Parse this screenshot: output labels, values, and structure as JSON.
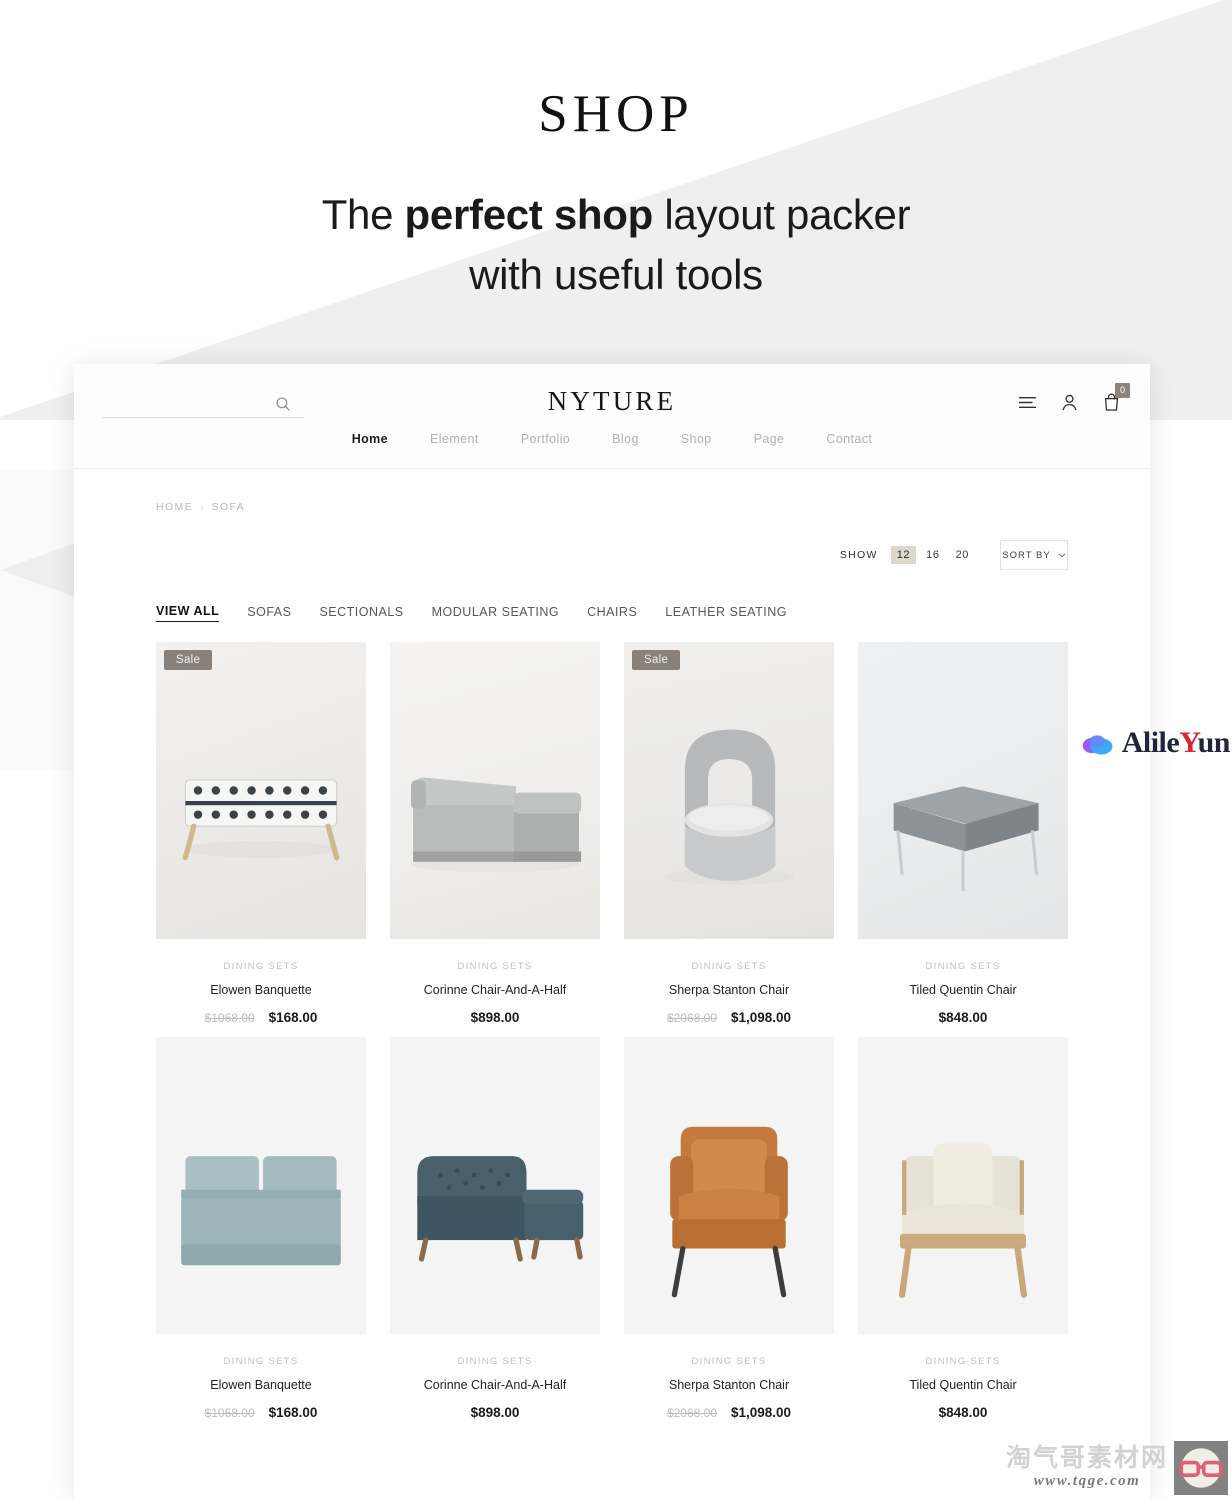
{
  "hero": {
    "title": "SHOP",
    "subtitle_line1_pre": "The ",
    "subtitle_line1_bold": "perfect shop",
    "subtitle_line1_post": " layout packer",
    "subtitle_line2": "with useful tools"
  },
  "header": {
    "brand": "NYTURE",
    "search_placeholder": "",
    "search_value": "",
    "icons": {
      "search": "search-icon",
      "menu": "hamburger-menu-icon",
      "account": "user-account-icon",
      "cart": "shopping-bag-icon"
    },
    "cart_count": "0",
    "nav": [
      {
        "label": "Home",
        "active": true
      },
      {
        "label": "Element",
        "active": false
      },
      {
        "label": "Portfolio",
        "active": false
      },
      {
        "label": "Blog",
        "active": false
      },
      {
        "label": "Shop",
        "active": false
      },
      {
        "label": "Page",
        "active": false
      },
      {
        "label": "Contact",
        "active": false
      }
    ]
  },
  "breadcrumb": {
    "home": "HOME",
    "separator": "›",
    "current": "SOFA"
  },
  "toolbar": {
    "show_label": "SHOW",
    "show_options": [
      {
        "label": "12",
        "active": true
      },
      {
        "label": "16",
        "active": false
      },
      {
        "label": "20",
        "active": false
      }
    ],
    "sort_label": "SORT BY",
    "sort_caret": "chevron-down-icon"
  },
  "category_tabs": [
    {
      "label": "VIEW ALL",
      "active": true
    },
    {
      "label": "SOFAS",
      "active": false
    },
    {
      "label": "SECTIONALS",
      "active": false
    },
    {
      "label": "MODULAR SEATING",
      "active": false
    },
    {
      "label": "CHAIRS",
      "active": false
    },
    {
      "label": "LEATHER SEATING",
      "active": false
    }
  ],
  "sale_badge_label": "Sale",
  "products_row1": [
    {
      "category": "DINING SETS",
      "name": "Elowen Banquette",
      "price_old": "$1068.00",
      "price_now": "$168.00",
      "on_sale": true,
      "image": "patterned-bench-gold-legs"
    },
    {
      "category": "DINING SETS",
      "name": "Corinne Chair-And-A-Half",
      "price_old": "",
      "price_now": "$898.00",
      "on_sale": false,
      "image": "grey-sectional-sofa"
    },
    {
      "category": "DINING SETS",
      "name": "Sherpa Stanton Chair",
      "price_old": "$2068.00",
      "price_now": "$1,098.00",
      "on_sale": true,
      "image": "grey-barrel-accent-chair"
    },
    {
      "category": "DINING SETS",
      "name": "Tiled Quentin Chair",
      "price_old": "",
      "price_now": "$848.00",
      "on_sale": false,
      "image": "grey-ottoman-metal-legs"
    }
  ],
  "products_row2": [
    {
      "category": "DINING SETS",
      "name": "Elowen Banquette",
      "price_old": "$1068.00",
      "price_now": "$168.00",
      "on_sale": false,
      "image": "blue-grey-loveseat"
    },
    {
      "category": "DINING SETS",
      "name": "Corinne Chair-And-A-Half",
      "price_old": "",
      "price_now": "$898.00",
      "on_sale": false,
      "image": "teal-tufted-chaise-sectional"
    },
    {
      "category": "DINING SETS",
      "name": "Sherpa Stanton Chair",
      "price_old": "$2068.00",
      "price_now": "$1,098.00",
      "on_sale": false,
      "image": "tan-leather-armchair"
    },
    {
      "category": "DINING SETS",
      "name": "Tiled Quentin Chair",
      "price_old": "",
      "price_now": "$848.00",
      "on_sale": false,
      "image": "cream-wood-frame-chair"
    }
  ],
  "watermarks": {
    "alileyun_pre": "Alile",
    "alileyun_hl": "Y",
    "alileyun_post": "un",
    "bottom_cn": "淘气哥素材网",
    "bottom_url": "www.tqge.com"
  },
  "colors": {
    "sale_badge": "#8a817b",
    "show_active": "#ded8cc",
    "accent_red": "#d9272e",
    "wedge_grey": "#efefef"
  }
}
